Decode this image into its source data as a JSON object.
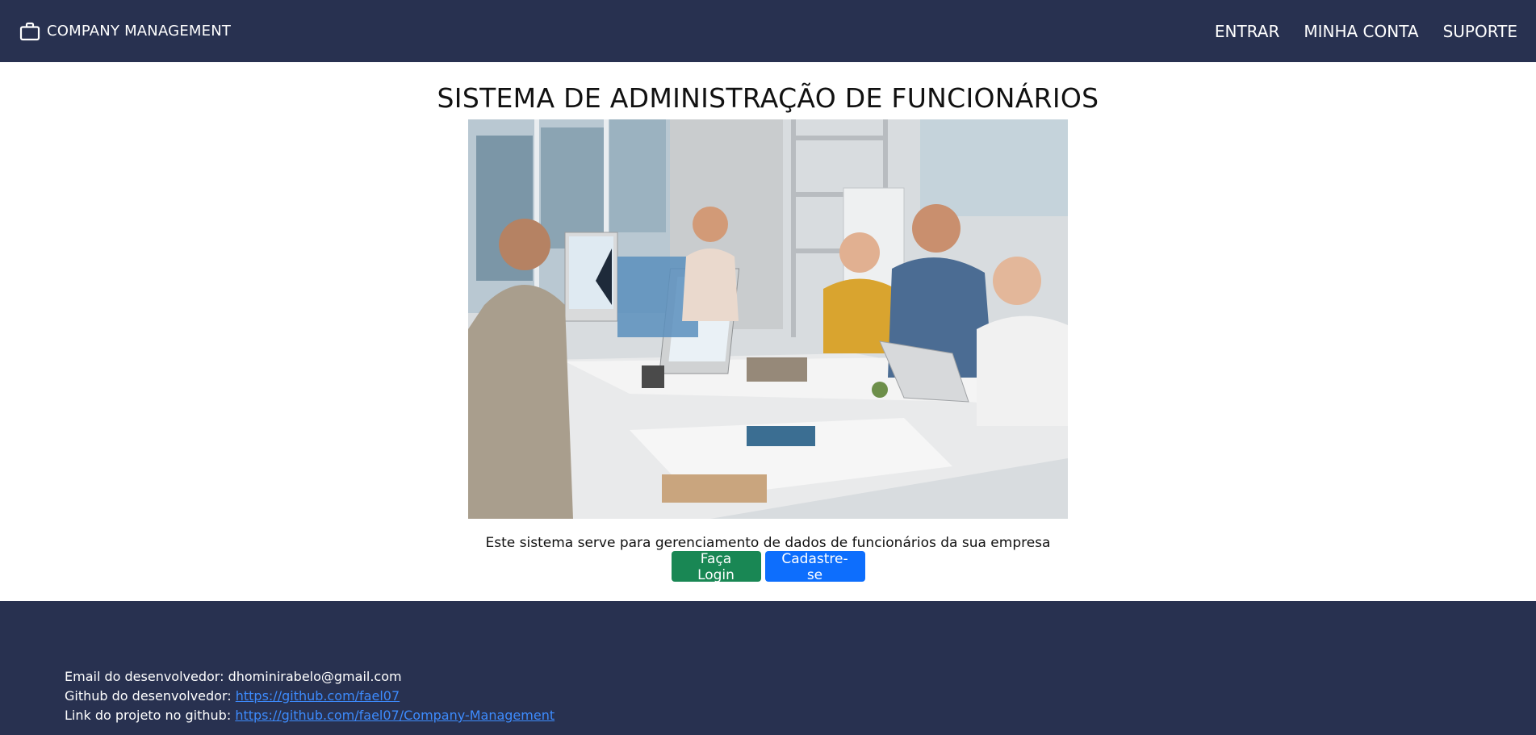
{
  "navbar": {
    "brand_label": "COMPANY MANAGEMENT",
    "brand_icon": "briefcase-icon",
    "links": [
      "ENTRAR",
      "MINHA CONTA",
      "SUPORTE"
    ],
    "background": "#283150"
  },
  "main": {
    "title": "SISTEMA DE ADMINISTRAÇÃO DE FUNCIONÁRIOS",
    "caption": "Este sistema serve para gerenciamento de dados de funcionários da sua empresa",
    "login_button": "Faça Login",
    "signup_button": "Cadastre-se"
  },
  "footer": {
    "email_label": "Email do desenvolvedor:",
    "email_value": "dhominirabelo@gmail.com",
    "github_label": "Github do desenvolvedor:",
    "github_link": "https://github.com/fael07",
    "project_label": "Link do projeto no github:",
    "project_link": "https://github.com/fael07/Company-Management"
  },
  "colors": {
    "navbar": "#283150",
    "login_button": "#198754",
    "signup_button": "#0d6efd",
    "link": "#3d8bfd"
  }
}
